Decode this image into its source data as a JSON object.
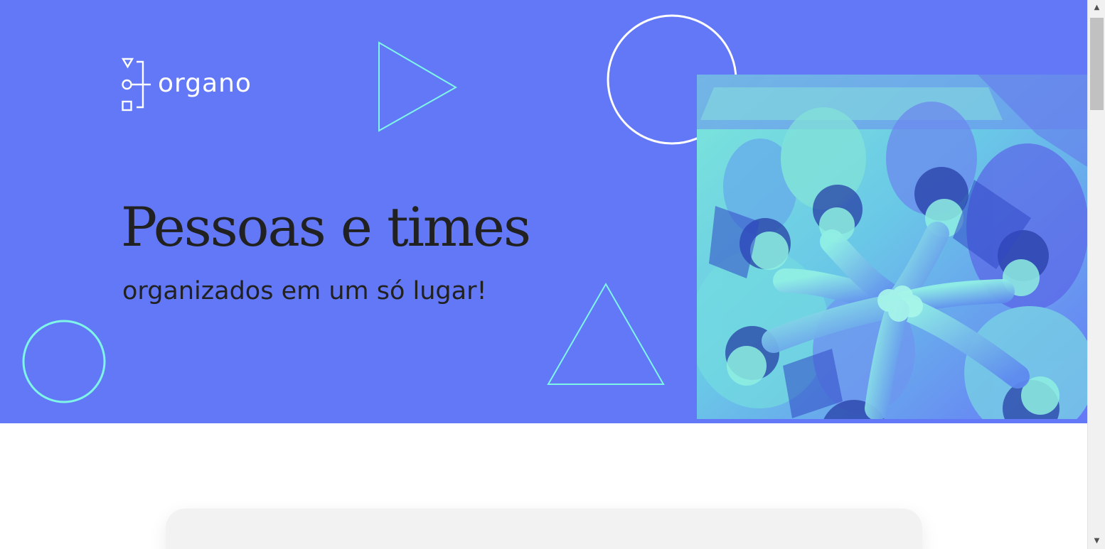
{
  "brand": {
    "name": "organo",
    "logo_icon": "org-chart-icon"
  },
  "hero": {
    "title": "Pessoas e times",
    "subtitle": "organizados em um só lugar!",
    "background_color": "#6278f7",
    "accent_color": "#7ff5e7",
    "image_name": "team-hands-together-photo"
  },
  "form": {
    "card_name": "team-form-card"
  },
  "scrollbar": {
    "up_icon": "▲",
    "down_icon": "▼"
  }
}
